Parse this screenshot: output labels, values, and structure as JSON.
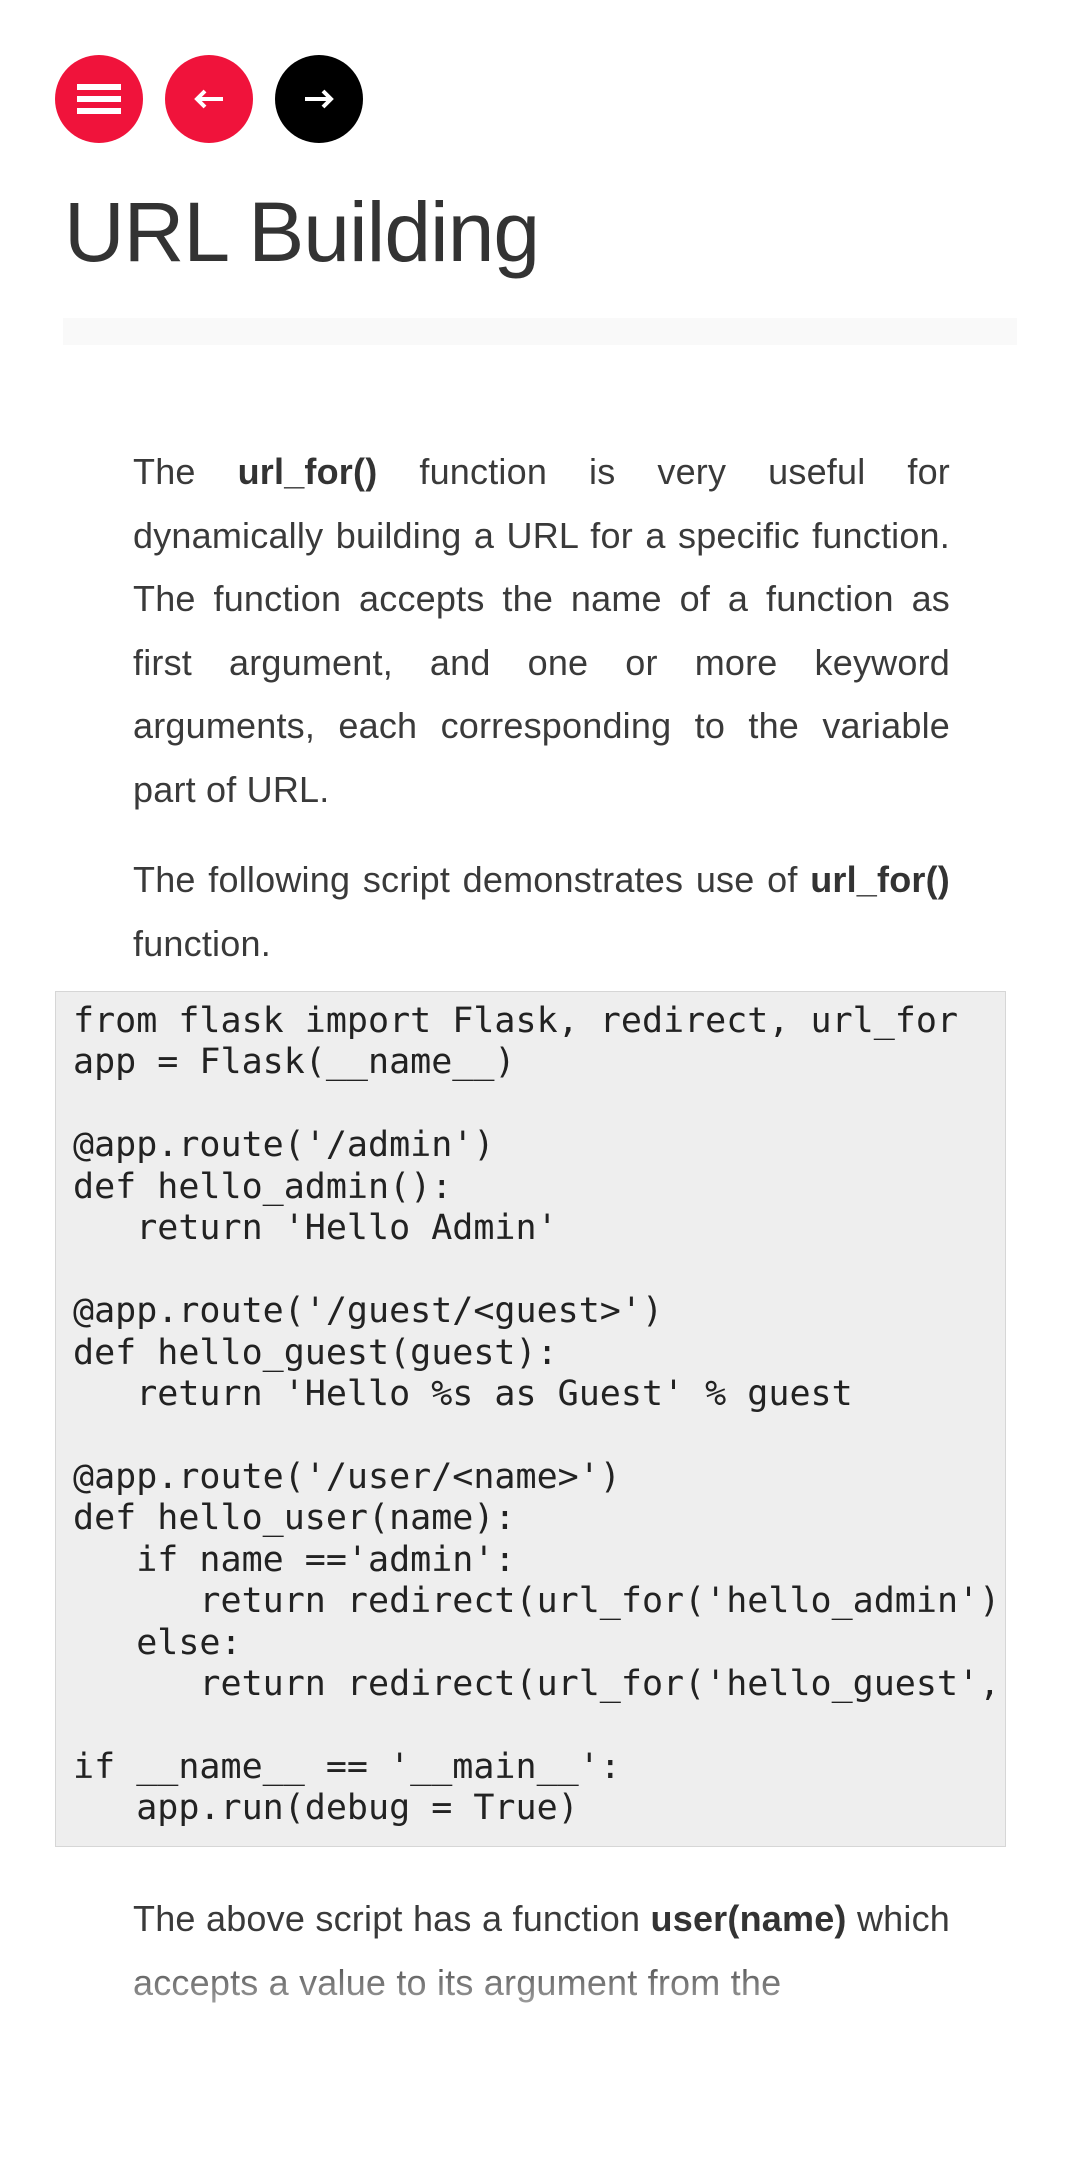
{
  "nav": {
    "menu_icon": "hamburger-menu-icon",
    "prev_icon": "arrow-left-icon",
    "next_icon": "arrow-right-icon",
    "colors": {
      "menu": "#f0133b",
      "prev": "#f0133b",
      "next": "#000000"
    }
  },
  "page": {
    "title": "URL Building"
  },
  "paragraphs": {
    "p1": {
      "before": "The ",
      "bold": "url_for()",
      "after": " function is very useful for dynamically building a URL for a specific function. The function accepts the name of a function as first argument, and one or more keyword arguments, each corresponding to the variable part of URL."
    },
    "p2": {
      "before": "The following script demonstrates use of ",
      "bold": "url_for()",
      "after": " function."
    },
    "p3": {
      "before": "The above script has a function ",
      "bold": "user(name)",
      "after": " which accepts a value to its argument from the"
    }
  },
  "code": {
    "lines": [
      "from flask import Flask, redirect, url_for",
      "app = Flask(__name__)",
      "",
      "@app.route('/admin')",
      "def hello_admin():",
      "   return 'Hello Admin'",
      "",
      "@app.route('/guest/<guest>')",
      "def hello_guest(guest):",
      "   return 'Hello %s as Guest' % guest",
      "",
      "@app.route('/user/<name>')",
      "def hello_user(name):",
      "   if name =='admin':",
      "      return redirect(url_for('hello_admin'))",
      "   else:",
      "      return redirect(url_for('hello_guest',",
      "",
      "if __name__ == '__main__':",
      "   app.run(debug = True)"
    ]
  }
}
